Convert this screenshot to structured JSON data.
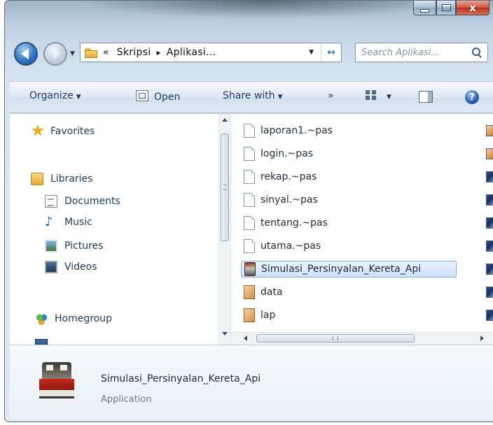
{
  "titlebar": {
    "minimize_icon": "minimize-icon",
    "maximize_icon": "maximize-icon",
    "close_label": "x"
  },
  "nav": {
    "back_icon": "back-arrow-icon",
    "forward_icon": "forward-arrow-icon",
    "breadcrumb_prefix": "«",
    "breadcrumb": [
      "Skripsi",
      "Aplikasi..."
    ],
    "breadcrumb_separator": "▸",
    "refresh_label": "↔",
    "search_placeholder": "Search Aplikasi..."
  },
  "toolbar": {
    "organize": "Organize",
    "open": "Open",
    "share_with": "Share with",
    "more": "»",
    "views_icon": "views-icon",
    "preview_pane_icon": "preview-pane-icon",
    "help_label": "?"
  },
  "navpane": {
    "favorites": "Favorites",
    "libraries": "Libraries",
    "documents": "Documents",
    "music": "Music",
    "pictures": "Pictures",
    "videos": "Videos",
    "homegroup": "Homegroup"
  },
  "files": [
    {
      "name": "laporan1.~pas",
      "icon": "file-icon",
      "side": "rave"
    },
    {
      "name": "login.~pas",
      "icon": "file-icon",
      "side": "rave"
    },
    {
      "name": "rekap.~pas",
      "icon": "file-icon",
      "side": "cube"
    },
    {
      "name": "sinyal.~pas",
      "icon": "file-icon",
      "side": "cube"
    },
    {
      "name": "tentang.~pas",
      "icon": "file-icon",
      "side": "cube"
    },
    {
      "name": "utama.~pas",
      "icon": "file-icon",
      "side": "cube"
    },
    {
      "name": "Simulasi_Persinyalan_Kereta_Api",
      "icon": "application-icon",
      "side": "cube",
      "selected": true
    },
    {
      "name": "data",
      "icon": "rave-report-icon",
      "side": "cube"
    },
    {
      "name": "lap",
      "icon": "rave-report-icon",
      "side": "cube"
    }
  ],
  "details": {
    "name": "Simulasi_Persinyalan_Kereta_Api",
    "type": "Application"
  }
}
